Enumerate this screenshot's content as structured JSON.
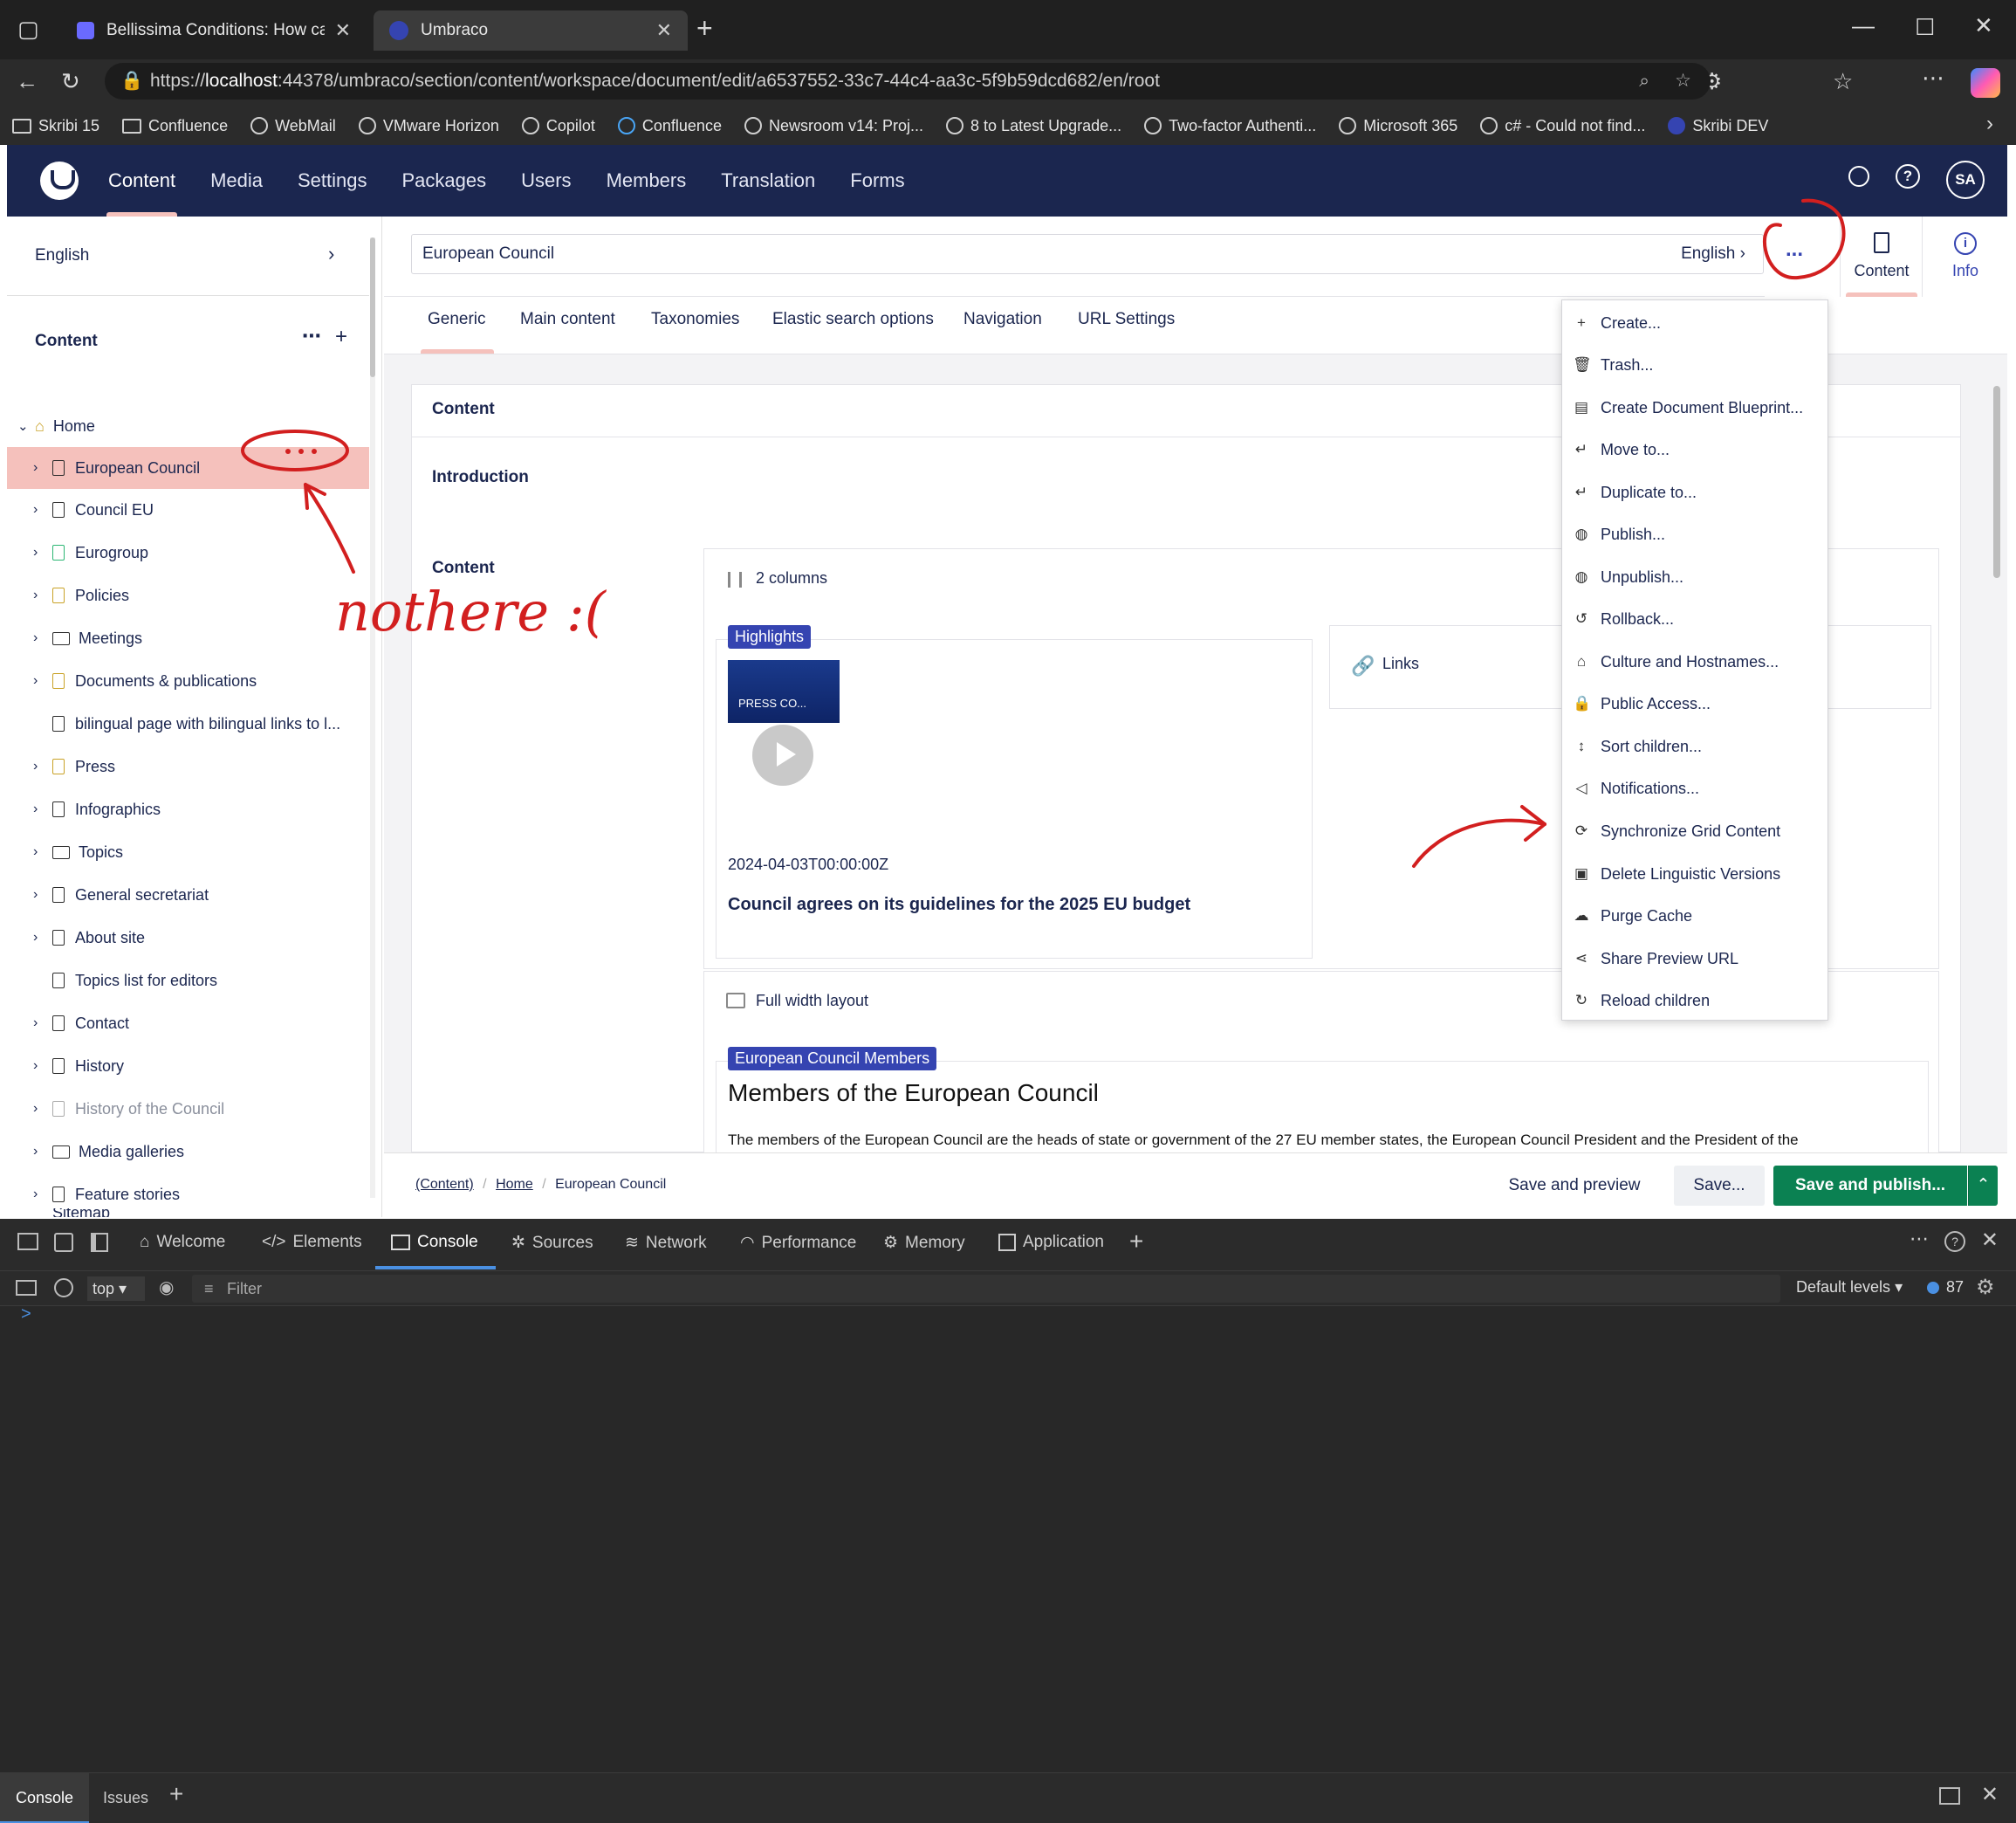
{
  "browser": {
    "tabs": [
      {
        "title": "Bellissima Conditions: How can I s"
      },
      {
        "title": "Umbraco"
      }
    ],
    "url_prefix": "https://",
    "url_host": "localhost",
    "url_rest": ":44378/umbraco/section/content/workspace/document/edit/a6537552-33c7-44c4-aa3c-5f9b59dcd682/en/root",
    "bookmarks": [
      "Skribi 15",
      "Confluence",
      "WebMail",
      "VMware Horizon",
      "Copilot",
      "Confluence",
      "Newsroom v14: Proj...",
      "8 to Latest Upgrade...",
      "Two-factor Authenti...",
      "Microsoft 365",
      "c# - Could not find...",
      "Skribi DEV"
    ]
  },
  "header": {
    "nav": [
      "Content",
      "Media",
      "Settings",
      "Packages",
      "Users",
      "Members",
      "Translation",
      "Forms"
    ],
    "avatar": "SA"
  },
  "sidebar": {
    "language": "English",
    "section_title": "Content",
    "root": "Home",
    "items": [
      "European Council",
      "Council EU",
      "Eurogroup",
      "Policies",
      "Meetings",
      "Documents & publications",
      "bilingual page with bilingual links to l...",
      "Press",
      "Infographics",
      "Topics",
      "General secretariat",
      "About site",
      "Topics list for editors",
      "Contact",
      "History",
      "History of the Council",
      "Media galleries",
      "Feature stories",
      "Sitemap"
    ]
  },
  "editor": {
    "name": "European Council",
    "culture": "English",
    "more": "...",
    "views": [
      "Content",
      "Info"
    ],
    "tabs": [
      "Generic",
      "Main content",
      "Taxonomies",
      "Elastic search options",
      "Navigation",
      "URL Settings"
    ],
    "group_title": "Content",
    "intro_label": "Introduction",
    "content_label": "Content",
    "grid": {
      "layout1": "2 columns",
      "highlights_badge": "Highlights",
      "thumb_caption": "PRESS CO...",
      "date": "2024-04-03T00:00:00Z",
      "headline": "Council agrees on its guidelines for the 2025 EU budget",
      "links_label": "Links",
      "layout2": "Full width layout",
      "members_badge": "European Council Members",
      "members_title": "Members of the European Council",
      "members_text": "The members of the European Council are the heads of state or government of the 27 EU member states, the European Council President and the President of the"
    }
  },
  "menu": {
    "items": [
      "Create...",
      "Trash...",
      "Create Document Blueprint...",
      "Move to...",
      "Duplicate to...",
      "Publish...",
      "Unpublish...",
      "Rollback...",
      "Culture and Hostnames...",
      "Public Access...",
      "Sort children...",
      "Notifications...",
      "Synchronize Grid Content",
      "Delete Linguistic Versions",
      "Purge Cache",
      "Share Preview URL",
      "Reload children"
    ]
  },
  "footer": {
    "breadcrumb": [
      "(Content)",
      "Home",
      "European Council"
    ],
    "save_preview": "Save and preview",
    "save": "Save...",
    "save_publish": "Save and publish..."
  },
  "annotation": {
    "note": "nothere :("
  },
  "devtools": {
    "tabs": [
      "Welcome",
      "Elements",
      "Console",
      "Sources",
      "Network",
      "Performance",
      "Memory",
      "Application"
    ],
    "context": "top",
    "filter_placeholder": "Filter",
    "levels": "Default levels",
    "message_count": "87",
    "prompt": ">",
    "bottom_tabs": [
      "Console",
      "Issues"
    ]
  },
  "colors": {
    "header_bg": "#1b264f",
    "selected_bg": "#f5c1bc",
    "publish_green": "#0b8152",
    "badge_blue": "#3544b1",
    "ink_red": "#d21f1f"
  }
}
